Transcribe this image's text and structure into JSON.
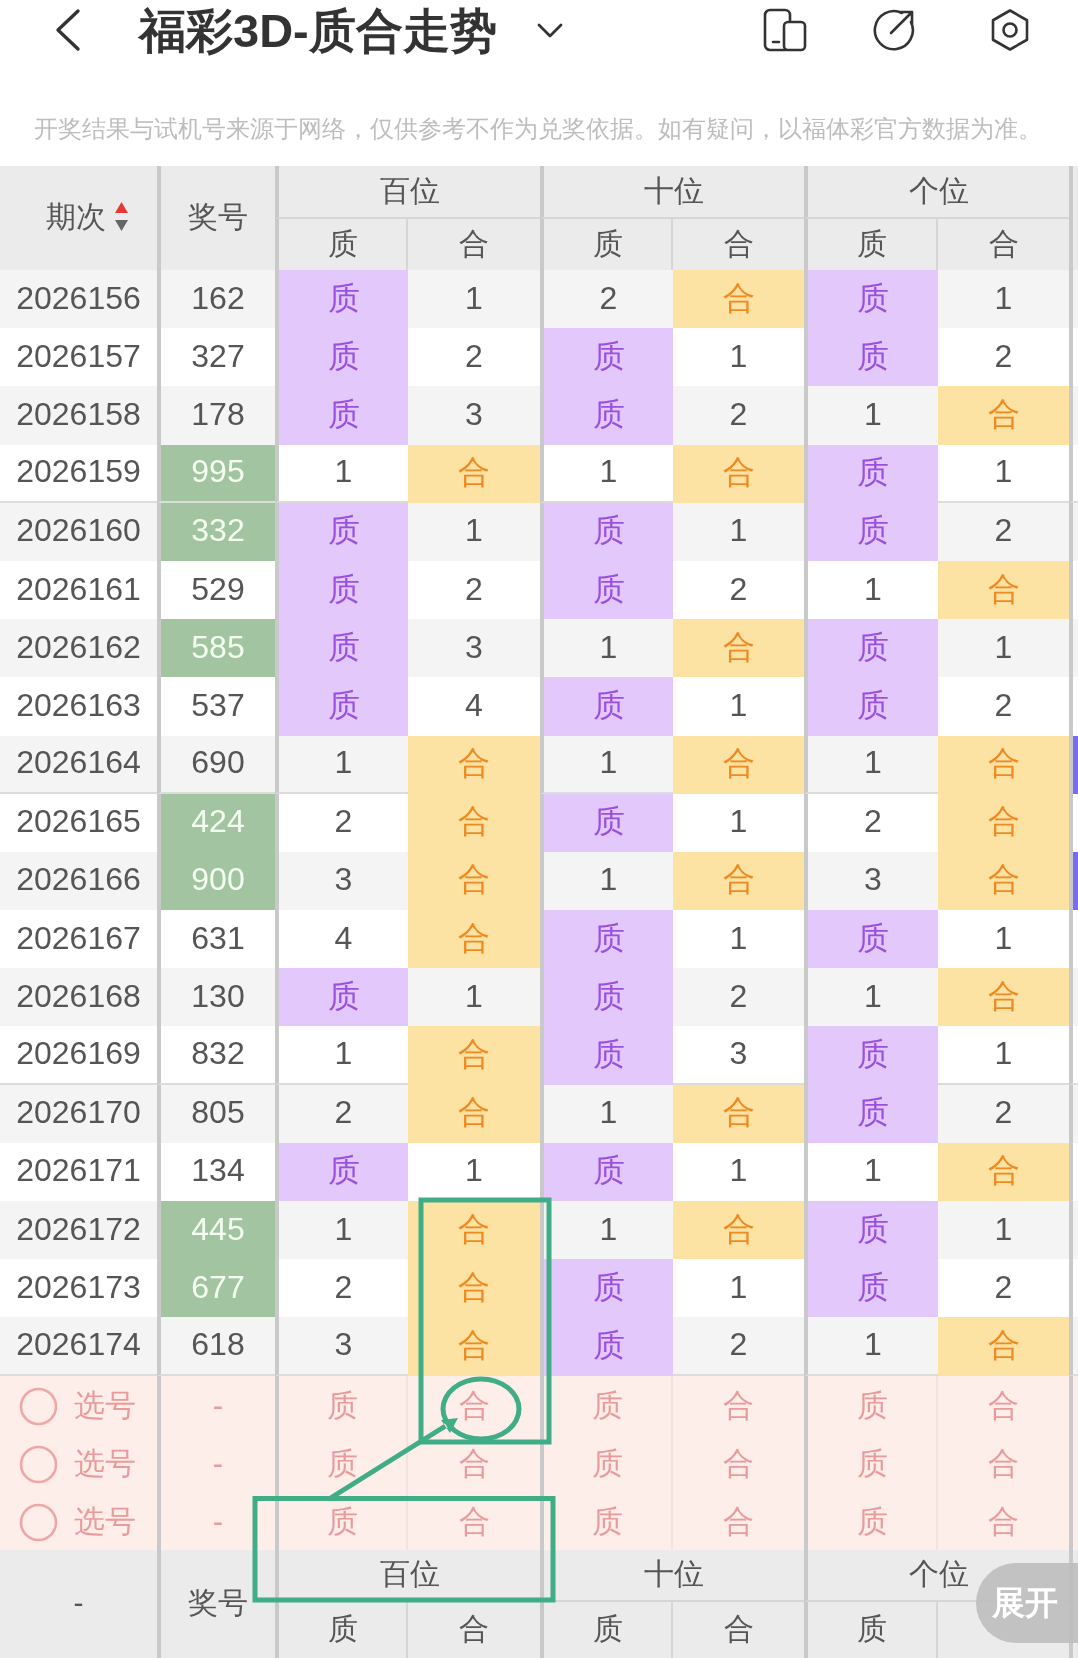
{
  "header": {
    "title": "福彩3D-质合走势"
  },
  "notice": "开奖结果与试机号来源于网络，仅供参考不作为兑奖依据。如有疑问，以福体彩官方数据为准。",
  "table": {
    "columns": {
      "issue": "期次",
      "sorted_ascending": true,
      "number": "奖号",
      "groups": [
        {
          "label": "百位",
          "sub": [
            "质",
            "合"
          ]
        },
        {
          "label": "十位",
          "sub": [
            "质",
            "合"
          ]
        },
        {
          "label": "个位",
          "sub": [
            "质",
            "合"
          ]
        }
      ]
    },
    "rows": [
      {
        "issue": "2026156",
        "number": "162",
        "pair": false,
        "cut_column_hit": false,
        "cells": [
          {
            "text": "质",
            "hit": true
          },
          {
            "text": "1",
            "hit": false
          },
          {
            "text": "2",
            "hit": false
          },
          {
            "text": "合",
            "hit": true
          },
          {
            "text": "质",
            "hit": true
          },
          {
            "text": "1",
            "hit": false
          }
        ]
      },
      {
        "issue": "2026157",
        "number": "327",
        "pair": false,
        "cut_column_hit": false,
        "cells": [
          {
            "text": "质",
            "hit": true
          },
          {
            "text": "2",
            "hit": false
          },
          {
            "text": "质",
            "hit": true
          },
          {
            "text": "1",
            "hit": false
          },
          {
            "text": "质",
            "hit": true
          },
          {
            "text": "2",
            "hit": false
          }
        ]
      },
      {
        "issue": "2026158",
        "number": "178",
        "pair": false,
        "cut_column_hit": false,
        "cells": [
          {
            "text": "质",
            "hit": true
          },
          {
            "text": "3",
            "hit": false
          },
          {
            "text": "质",
            "hit": true
          },
          {
            "text": "2",
            "hit": false
          },
          {
            "text": "1",
            "hit": false
          },
          {
            "text": "合",
            "hit": true
          }
        ]
      },
      {
        "issue": "2026159",
        "number": "995",
        "pair": true,
        "cut_column_hit": false,
        "cells": [
          {
            "text": "1",
            "hit": false
          },
          {
            "text": "合",
            "hit": true
          },
          {
            "text": "1",
            "hit": false
          },
          {
            "text": "合",
            "hit": true
          },
          {
            "text": "质",
            "hit": true
          },
          {
            "text": "1",
            "hit": false
          }
        ]
      },
      {
        "issue": "2026160",
        "number": "332",
        "pair": true,
        "cut_column_hit": false,
        "cells": [
          {
            "text": "质",
            "hit": true
          },
          {
            "text": "1",
            "hit": false
          },
          {
            "text": "质",
            "hit": true
          },
          {
            "text": "1",
            "hit": false
          },
          {
            "text": "质",
            "hit": true
          },
          {
            "text": "2",
            "hit": false
          }
        ]
      },
      {
        "issue": "2026161",
        "number": "529",
        "pair": false,
        "cut_column_hit": false,
        "cells": [
          {
            "text": "质",
            "hit": true
          },
          {
            "text": "2",
            "hit": false
          },
          {
            "text": "质",
            "hit": true
          },
          {
            "text": "2",
            "hit": false
          },
          {
            "text": "1",
            "hit": false
          },
          {
            "text": "合",
            "hit": true
          }
        ]
      },
      {
        "issue": "2026162",
        "number": "585",
        "pair": true,
        "cut_column_hit": false,
        "cells": [
          {
            "text": "质",
            "hit": true
          },
          {
            "text": "3",
            "hit": false
          },
          {
            "text": "1",
            "hit": false
          },
          {
            "text": "合",
            "hit": true
          },
          {
            "text": "质",
            "hit": true
          },
          {
            "text": "1",
            "hit": false
          }
        ]
      },
      {
        "issue": "2026163",
        "number": "537",
        "pair": false,
        "cut_column_hit": false,
        "cells": [
          {
            "text": "质",
            "hit": true
          },
          {
            "text": "4",
            "hit": false
          },
          {
            "text": "质",
            "hit": true
          },
          {
            "text": "1",
            "hit": false
          },
          {
            "text": "质",
            "hit": true
          },
          {
            "text": "2",
            "hit": false
          }
        ]
      },
      {
        "issue": "2026164",
        "number": "690",
        "pair": false,
        "cut_column_hit": true,
        "cells": [
          {
            "text": "1",
            "hit": false
          },
          {
            "text": "合",
            "hit": true
          },
          {
            "text": "1",
            "hit": false
          },
          {
            "text": "合",
            "hit": true
          },
          {
            "text": "1",
            "hit": false
          },
          {
            "text": "合",
            "hit": true
          }
        ]
      },
      {
        "issue": "2026165",
        "number": "424",
        "pair": true,
        "cut_column_hit": false,
        "cells": [
          {
            "text": "2",
            "hit": false
          },
          {
            "text": "合",
            "hit": true
          },
          {
            "text": "质",
            "hit": true
          },
          {
            "text": "1",
            "hit": false
          },
          {
            "text": "2",
            "hit": false
          },
          {
            "text": "合",
            "hit": true
          }
        ]
      },
      {
        "issue": "2026166",
        "number": "900",
        "pair": true,
        "cut_column_hit": true,
        "cells": [
          {
            "text": "3",
            "hit": false
          },
          {
            "text": "合",
            "hit": true
          },
          {
            "text": "1",
            "hit": false
          },
          {
            "text": "合",
            "hit": true
          },
          {
            "text": "3",
            "hit": false
          },
          {
            "text": "合",
            "hit": true
          }
        ]
      },
      {
        "issue": "2026167",
        "number": "631",
        "pair": false,
        "cut_column_hit": false,
        "cells": [
          {
            "text": "4",
            "hit": false
          },
          {
            "text": "合",
            "hit": true
          },
          {
            "text": "质",
            "hit": true
          },
          {
            "text": "1",
            "hit": false
          },
          {
            "text": "质",
            "hit": true
          },
          {
            "text": "1",
            "hit": false
          }
        ]
      },
      {
        "issue": "2026168",
        "number": "130",
        "pair": false,
        "cut_column_hit": false,
        "cells": [
          {
            "text": "质",
            "hit": true
          },
          {
            "text": "1",
            "hit": false
          },
          {
            "text": "质",
            "hit": true
          },
          {
            "text": "2",
            "hit": false
          },
          {
            "text": "1",
            "hit": false
          },
          {
            "text": "合",
            "hit": true
          }
        ]
      },
      {
        "issue": "2026169",
        "number": "832",
        "pair": false,
        "cut_column_hit": false,
        "cells": [
          {
            "text": "1",
            "hit": false
          },
          {
            "text": "合",
            "hit": true
          },
          {
            "text": "质",
            "hit": true
          },
          {
            "text": "3",
            "hit": false
          },
          {
            "text": "质",
            "hit": true
          },
          {
            "text": "1",
            "hit": false
          }
        ]
      },
      {
        "issue": "2026170",
        "number": "805",
        "pair": false,
        "cut_column_hit": false,
        "cells": [
          {
            "text": "2",
            "hit": false
          },
          {
            "text": "合",
            "hit": true
          },
          {
            "text": "1",
            "hit": false
          },
          {
            "text": "合",
            "hit": true
          },
          {
            "text": "质",
            "hit": true
          },
          {
            "text": "2",
            "hit": false
          }
        ]
      },
      {
        "issue": "2026171",
        "number": "134",
        "pair": false,
        "cut_column_hit": false,
        "cells": [
          {
            "text": "质",
            "hit": true
          },
          {
            "text": "1",
            "hit": false
          },
          {
            "text": "质",
            "hit": true
          },
          {
            "text": "1",
            "hit": false
          },
          {
            "text": "1",
            "hit": false
          },
          {
            "text": "合",
            "hit": true
          }
        ]
      },
      {
        "issue": "2026172",
        "number": "445",
        "pair": true,
        "cut_column_hit": false,
        "cells": [
          {
            "text": "1",
            "hit": false
          },
          {
            "text": "合",
            "hit": true
          },
          {
            "text": "1",
            "hit": false
          },
          {
            "text": "合",
            "hit": true
          },
          {
            "text": "质",
            "hit": true
          },
          {
            "text": "1",
            "hit": false
          }
        ]
      },
      {
        "issue": "2026173",
        "number": "677",
        "pair": true,
        "cut_column_hit": false,
        "cells": [
          {
            "text": "2",
            "hit": false
          },
          {
            "text": "合",
            "hit": true
          },
          {
            "text": "质",
            "hit": true
          },
          {
            "text": "1",
            "hit": false
          },
          {
            "text": "质",
            "hit": true
          },
          {
            "text": "2",
            "hit": false
          }
        ]
      },
      {
        "issue": "2026174",
        "number": "618",
        "pair": false,
        "cut_column_hit": false,
        "cells": [
          {
            "text": "3",
            "hit": false
          },
          {
            "text": "合",
            "hit": true
          },
          {
            "text": "质",
            "hit": true
          },
          {
            "text": "2",
            "hit": false
          },
          {
            "text": "1",
            "hit": false
          },
          {
            "text": "合",
            "hit": true
          }
        ]
      }
    ],
    "pick_rows": [
      {
        "label": "选号",
        "checked": false,
        "number": "-",
        "cells": [
          "质",
          "合",
          "质",
          "合",
          "质",
          "合"
        ]
      },
      {
        "label": "选号",
        "checked": false,
        "number": "-",
        "cells": [
          "质",
          "合",
          "质",
          "合",
          "质",
          "合"
        ]
      },
      {
        "label": "选号",
        "checked": false,
        "number": "-",
        "cells": [
          "质",
          "合",
          "质",
          "合",
          "质",
          "合"
        ]
      }
    ],
    "footer": {
      "issue": "-",
      "number": "奖号",
      "groups": [
        {
          "label": "百位",
          "sub": [
            "质",
            "合"
          ]
        },
        {
          "label": "十位",
          "sub": [
            "质",
            "合"
          ]
        },
        {
          "label": "个位",
          "sub": [
            "质"
          ]
        }
      ]
    }
  },
  "expand_button": "展开"
}
